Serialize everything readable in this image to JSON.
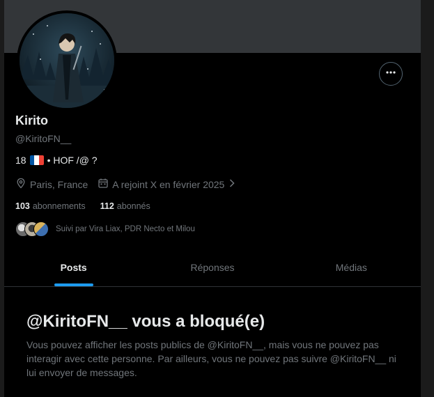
{
  "profile": {
    "display_name": "Kirito",
    "handle": "@KiritoFN__",
    "bio": {
      "age": "18",
      "flag_icon": "france-flag-icon",
      "rest": "• HOF /@ ?"
    },
    "location": "Paris, France",
    "joined": "A rejoint X en février 2025",
    "following_count": "103",
    "following_label": "abonnements",
    "followers_count": "112",
    "followers_label": "abonnés",
    "followed_by": "Suivi par Vira Liax, PDR Necto et Milou"
  },
  "icons": {
    "more": "more-horizontal-icon",
    "location": "location-pin-icon",
    "calendar": "calendar-icon",
    "chevron": "chevron-right-icon"
  },
  "tabs": [
    {
      "label": "Posts",
      "active": true
    },
    {
      "label": "Réponses",
      "active": false
    },
    {
      "label": "Médias",
      "active": false
    }
  ],
  "blocked": {
    "title": "@KiritoFN__ vous a bloqué(e)",
    "body": "Vous pouvez afficher les posts publics de @KiritoFN__, mais vous ne pouvez pas interagir avec cette personne. Par ailleurs, vous ne pouvez pas suivre @KiritoFN__ ni lui envoyer de messages."
  },
  "colors": {
    "background": "#000000",
    "accent": "#1d9bf0",
    "text_primary": "#e7e9ea",
    "text_secondary": "#71767b",
    "banner": "#333639"
  }
}
